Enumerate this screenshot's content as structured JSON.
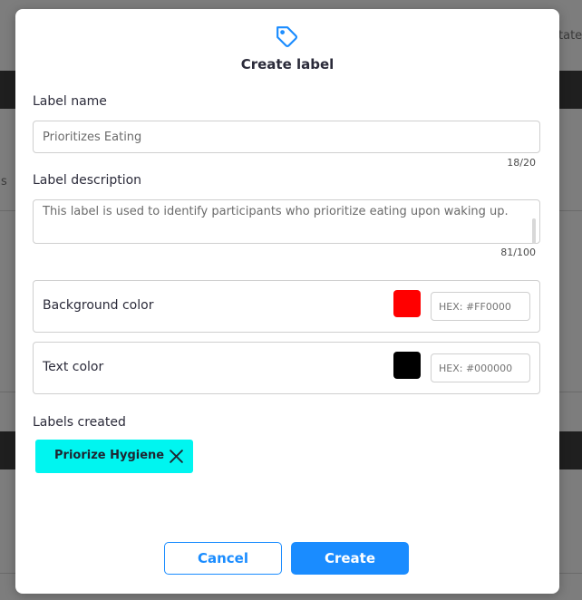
{
  "background": {
    "partial_text_right": "tate",
    "partial_text_left": "s"
  },
  "modal": {
    "icon": "tag-icon",
    "title": "Create label",
    "label_name": {
      "label": "Label name",
      "value": "Prioritizes Eating",
      "counter": "18/20"
    },
    "label_description": {
      "label": "Label description",
      "value": "This label is used to identify participants who prioritize eating upon waking up.",
      "counter": "81/100"
    },
    "background_color": {
      "label": "Background color",
      "swatch": "#FF0000",
      "placeholder": "HEX: #FF0000"
    },
    "text_color": {
      "label": "Text color",
      "swatch": "#000000",
      "placeholder": "HEX: #000000"
    },
    "labels_created": {
      "heading": "Labels created",
      "items": [
        {
          "text": "Priorize Hygiene",
          "color": "#00F5F0"
        }
      ]
    },
    "buttons": {
      "cancel": "Cancel",
      "create": "Create"
    },
    "accent_color": "#1A8CFF"
  }
}
